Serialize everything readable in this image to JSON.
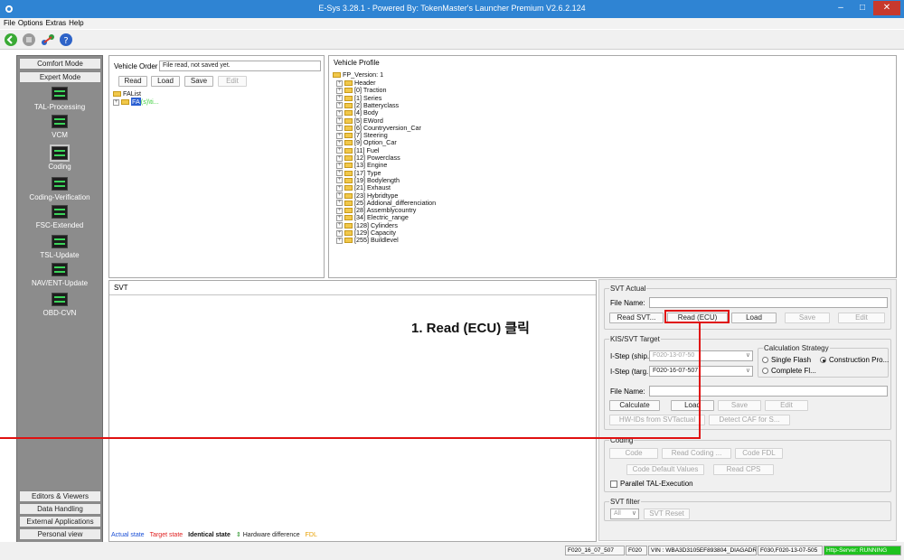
{
  "window": {
    "title": "E-Sys 3.28.1 - Powered By: TokenMaster's Launcher Premium V2.6.2.124"
  },
  "menu": {
    "file": "File",
    "options": "Options",
    "extras": "Extras",
    "help": "Help"
  },
  "sidebar": {
    "comfort_mode": "Comfort Mode",
    "expert_mode": "Expert Mode",
    "items": [
      {
        "label": "TAL-Processing"
      },
      {
        "label": "VCM"
      },
      {
        "label": "Coding"
      },
      {
        "label": "Coding-Verification"
      },
      {
        "label": "FSC-Extended"
      },
      {
        "label": "TSL-Update"
      },
      {
        "label": "NAV/ENT-Update"
      },
      {
        "label": "OBD-CVN"
      }
    ],
    "bottom": [
      "Editors & Viewers",
      "Data Handling",
      "External Applications",
      "Personal view"
    ]
  },
  "vehicle_order": {
    "label": "Vehicle Order",
    "status": "File read, not saved yet.",
    "buttons": {
      "read": "Read",
      "load": "Load",
      "save": "Save",
      "edit": "Edit"
    },
    "tree": {
      "root": "FAList",
      "child_selected": "FA",
      "child_suffix": "(s)\\ti..."
    }
  },
  "vehicle_profile": {
    "title": "Vehicle Profile",
    "root": "FP_Version: 1",
    "items": [
      "Header",
      "[0] Traction",
      "[1] Series",
      "[2] Batteryclass",
      "[4] Body",
      "[5] EWord",
      "[6] Countryversion_Car",
      "[7] Steering",
      "[9] Option_Car",
      "[11] Fuel",
      "[12] Powerclass",
      "[13] Engine",
      "[17] Type",
      "[19] Bodylength",
      "[21] Exhaust",
      "[23] Hybridtype",
      "[25] Addional_differenciation",
      "[28] Assemblycountry",
      "[34] Electric_range",
      "[128] Cylinders",
      "[129] Capacity",
      "[255] Buildlevel"
    ]
  },
  "svt": {
    "title": "SVT"
  },
  "svt_actual": {
    "title": "SVT Actual",
    "file_name_label": "File Name:",
    "buttons": {
      "read_svt": "Read SVT...",
      "read_ecu": "Read (ECU)",
      "load": "Load",
      "save": "Save",
      "edit": "Edit"
    }
  },
  "kis_svt_target": {
    "title": "KIS/SVT Target",
    "istep_ship_label": "I-Step (ship...",
    "istep_ship_value": "F020-13-07-50",
    "istep_target_label": "I-Step (targ...",
    "istep_target_value": "F020-16-07-507",
    "calc_strategy": "Calculation Strategy",
    "single_flash": "Single Flash",
    "construction": "Construction Pro...",
    "complete_fl": "Complete Fl...",
    "file_name_label": "File Name:",
    "buttons": {
      "calculate": "Calculate",
      "load": "Load",
      "save": "Save",
      "edit": "Edit",
      "hw_ids": "HW-IDs from SVTactual",
      "detect_caf": "Detect CAF for S..."
    }
  },
  "coding": {
    "title": "Coding",
    "buttons": {
      "code": "Code",
      "read_coding": "Read Coding ...",
      "code_fdl": "Code FDL",
      "code_default": "Code Default Values",
      "read_cps": "Read CPS"
    },
    "parallel_tal": "Parallel TAL-Execution"
  },
  "svt_filter": {
    "title": "SVT filter",
    "select_value": "All",
    "reset": "SVT Reset"
  },
  "legend": {
    "actual": "Actual state",
    "target": "Target state",
    "identical": "Identical state",
    "hw_diff": "Hardware difference",
    "fdl": "FDL",
    "colors": {
      "actual": "#1a4fd6",
      "target": "#e02020",
      "identical": "#111111",
      "hw_diff": "#1f8f1f",
      "fdl": "#e8a000"
    }
  },
  "annotation": {
    "text": "1. Read (ECU) 클릭"
  },
  "statusbar": {
    "istep": "F020_16_07_507",
    "series": "F020",
    "vin": "VIN : WBA3D3105EF893804_DIAGADR10",
    "istep2": "F030,F020-13-07-505",
    "http_server": "Http-Server: RUNNING"
  }
}
